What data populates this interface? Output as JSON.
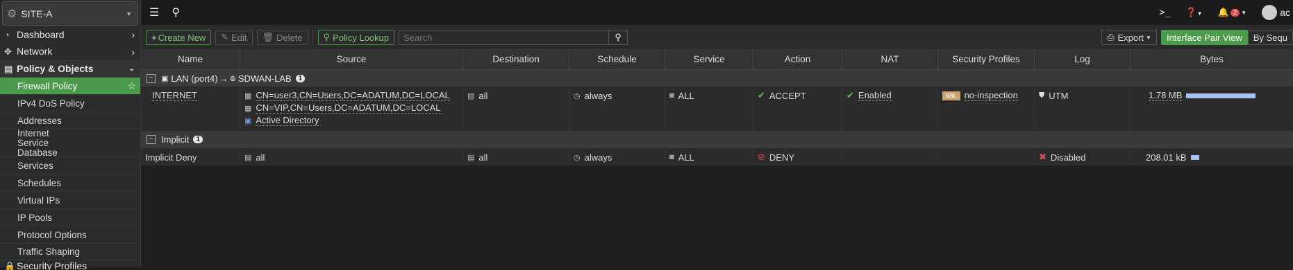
{
  "sidebar": {
    "site": "SITE-A",
    "top_items": [
      {
        "label": "Dashboard",
        "icon": "dashboard-icon"
      },
      {
        "label": "Network",
        "icon": "network-icon"
      },
      {
        "label": "Policy & Objects",
        "icon": "policy-icon"
      }
    ],
    "sub_items": [
      "Firewall Policy",
      "IPv4 DoS Policy",
      "Addresses",
      "Internet Service Database",
      "Services",
      "Schedules",
      "Virtual IPs",
      "IP Pools",
      "Protocol Options",
      "Traffic Shaping"
    ],
    "partial_item": "Security Profiles"
  },
  "topbar": {
    "notifications": "2",
    "user": "ac"
  },
  "toolbar": {
    "create_new": "Create New",
    "edit": "Edit",
    "delete": "Delete",
    "policy_lookup": "Policy Lookup",
    "search_placeholder": "Search",
    "export": "Export",
    "interface_pair_view": "Interface Pair View",
    "by_sequence": "By Sequ"
  },
  "table": {
    "columns": [
      "Name",
      "Source",
      "Destination",
      "Schedule",
      "Service",
      "Action",
      "NAT",
      "Security Profiles",
      "Log",
      "Bytes"
    ],
    "groups": [
      {
        "label": "LAN (port4)",
        "arrow": "→",
        "dest": "SDWAN-LAB",
        "count": "1",
        "rows": [
          {
            "name": "INTERNET",
            "sources": [
              "CN=user3,CN=Users,DC=ADATUM,DC=LOCAL",
              "CN=VIP,CN=Users,DC=ADATUM,DC=LOCAL",
              "Active Directory"
            ],
            "destination": "all",
            "schedule": "always",
            "service": "ALL",
            "action": "ACCEPT",
            "nat": "Enabled",
            "ssl_badge": "SSL",
            "security_profile": "no-inspection",
            "log": "UTM",
            "bytes": "1.78 MB",
            "bytes_fraction": 1.0
          }
        ]
      },
      {
        "label": "Implicit",
        "count": "1",
        "rows": [
          {
            "name": "Implicit Deny",
            "sources": [
              "all"
            ],
            "destination": "all",
            "schedule": "always",
            "service": "ALL",
            "action": "DENY",
            "nat": "",
            "log": "Disabled",
            "bytes": "208.01 kB",
            "bytes_fraction": 0.12
          }
        ]
      }
    ]
  }
}
